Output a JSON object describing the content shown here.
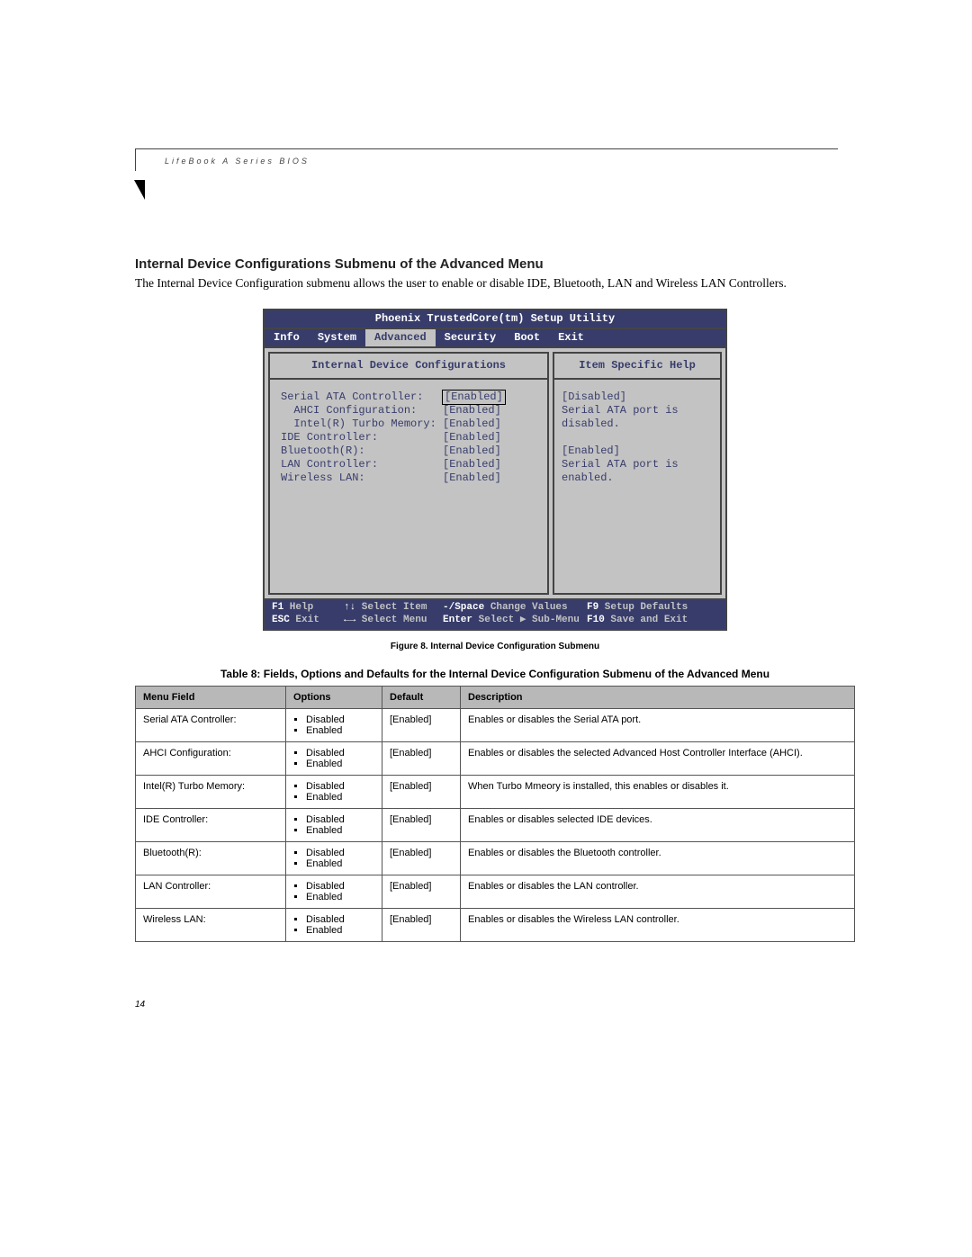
{
  "running_head": "LifeBook A Series BIOS",
  "heading": "Internal Device Configurations Submenu of the Advanced Menu",
  "paragraph": "The Internal Device Configuration submenu allows the user to enable or disable IDE, Bluetooth, LAN and Wireless LAN Controllers.",
  "bios": {
    "title": "Phoenix TrustedCore(tm) Setup Utility",
    "menu": [
      "Info",
      "System",
      "Advanced",
      "Security",
      "Boot",
      "Exit"
    ],
    "active_menu_index": 2,
    "panel_title": "Internal Device Configurations",
    "help_title": "Item Specific Help",
    "items": [
      {
        "label": "Serial ATA Controller:",
        "indent": 0,
        "value": "[Enabled]",
        "selected": true
      },
      {
        "label": "AHCI Configuration:",
        "indent": 1,
        "value": "[Enabled]",
        "selected": false
      },
      {
        "label": "Intel(R) Turbo Memory:",
        "indent": 1,
        "value": "[Enabled]",
        "selected": false
      },
      {
        "label": "IDE Controller:",
        "indent": 0,
        "value": "[Enabled]",
        "selected": false
      },
      {
        "label": "Bluetooth(R):",
        "indent": 0,
        "value": "[Enabled]",
        "selected": false
      },
      {
        "label": "LAN Controller:",
        "indent": 0,
        "value": "[Enabled]",
        "selected": false
      },
      {
        "label": "Wireless LAN:",
        "indent": 0,
        "value": "[Enabled]",
        "selected": false
      }
    ],
    "help_lines": [
      "[Disabled]",
      "Serial ATA port is",
      "disabled.",
      "",
      "[Enabled]",
      "Serial ATA port is",
      "enabled."
    ],
    "footer": {
      "row1": [
        {
          "k": "F1",
          "t": "Help"
        },
        {
          "k": "↑↓",
          "t": "Select Item"
        },
        {
          "k": "-/Space",
          "t": "Change Values"
        },
        {
          "k": "F9",
          "t": "Setup Defaults"
        }
      ],
      "row2": [
        {
          "k": "ESC",
          "t": "Exit"
        },
        {
          "k": "←→",
          "t": "Select Menu"
        },
        {
          "k": "Enter",
          "t": "Select ▶ Sub-Menu"
        },
        {
          "k": "F10",
          "t": "Save and Exit"
        }
      ]
    }
  },
  "figure_caption": "Figure 8.  Internal Device Configuration Submenu",
  "table_caption": "Table 8: Fields, Options and Defaults for the Internal Device Configuration Submenu of the Advanced Menu",
  "table": {
    "headers": [
      "Menu Field",
      "Options",
      "Default",
      "Description"
    ],
    "rows": [
      {
        "field": "Serial ATA Controller:",
        "indent": false,
        "options": [
          "Disabled",
          "Enabled"
        ],
        "default": "[Enabled]",
        "desc": "Enables or disables the Serial ATA port."
      },
      {
        "field": "AHCI Configuration:",
        "indent": true,
        "options": [
          "Disabled",
          "Enabled"
        ],
        "default": "[Enabled]",
        "desc": "Enables or disables the selected Advanced Host Controller Interface (AHCI)."
      },
      {
        "field": "Intel(R) Turbo Memory:",
        "indent": true,
        "options": [
          "Disabled",
          "Enabled"
        ],
        "default": "[Enabled]",
        "desc": "When Turbo Mmeory is installed, this enables or disables it."
      },
      {
        "field": "IDE Controller:",
        "indent": false,
        "options": [
          "Disabled",
          "Enabled"
        ],
        "default": "[Enabled]",
        "desc": "Enables or disables selected IDE devices."
      },
      {
        "field": "Bluetooth(R):",
        "indent": false,
        "options": [
          "Disabled",
          "Enabled"
        ],
        "default": "[Enabled]",
        "desc": "Enables or disables the Bluetooth controller."
      },
      {
        "field": "LAN Controller:",
        "indent": false,
        "options": [
          "Disabled",
          "Enabled"
        ],
        "default": "[Enabled]",
        "desc": "Enables or disables the LAN controller."
      },
      {
        "field": "Wireless LAN:",
        "indent": false,
        "options": [
          "Disabled",
          "Enabled"
        ],
        "default": "[Enabled]",
        "desc": "Enables or disables the Wireless LAN controller."
      }
    ]
  },
  "page_number": "14"
}
